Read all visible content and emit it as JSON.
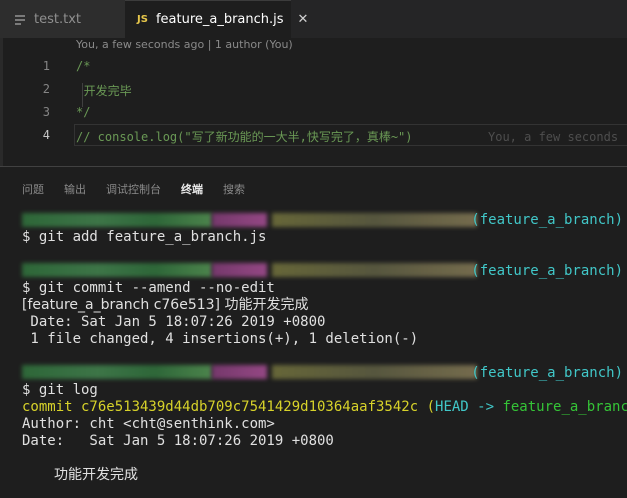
{
  "tabs": [
    {
      "label": "test.txt"
    },
    {
      "label": "feature_a_branch.js",
      "icon_text": "JS",
      "close": "✕"
    }
  ],
  "editor": {
    "codelens": "You, a few seconds ago | 1 author (You)",
    "lines": [
      {
        "number": "1",
        "text": "/*"
      },
      {
        "number": "2",
        "text": "  开发完毕"
      },
      {
        "number": "3",
        "text": "*/"
      },
      {
        "number": "4",
        "text": "// console.log(\"写了新功能的一大半,快写完了，真棒~\")"
      }
    ],
    "blame": "You, a few seconds"
  },
  "panel": {
    "tabs": [
      "问题",
      "输出",
      "调试控制台",
      "终端",
      "搜索"
    ],
    "active_tab": "终端"
  },
  "terminal": {
    "prompt_branch": "(feature_a_branch)",
    "cmd1": "$ git add feature_a_branch.js",
    "cmd2": "$ git commit --amend --no-edit",
    "commit_result": "[feature_a_branch c76e513] 功能开发完成",
    "commit_date": " Date: Sat Jan 5 18:07:26 2019 +0800",
    "commit_stats": " 1 file changed, 4 insertions(+), 1 deletion(-)",
    "cmd3": "$ git log",
    "log_commit_prefix": "commit c76e513439d44db709c7541429d10364aaf3542c ",
    "log_head_open": "(",
    "log_head": "HEAD -> ",
    "log_branch": "feature_a_branch",
    "log_head_close": ")",
    "log_author": "Author: cht <cht@senthink.com>",
    "log_date": "Date:   Sat Jan 5 18:07:26 2019 +0800",
    "log_message": "功能开发完成"
  },
  "colors": {
    "comment": "#6a9955",
    "cyan": "#41c7c8",
    "yellow": "#d7d22a",
    "green": "#35c437"
  }
}
